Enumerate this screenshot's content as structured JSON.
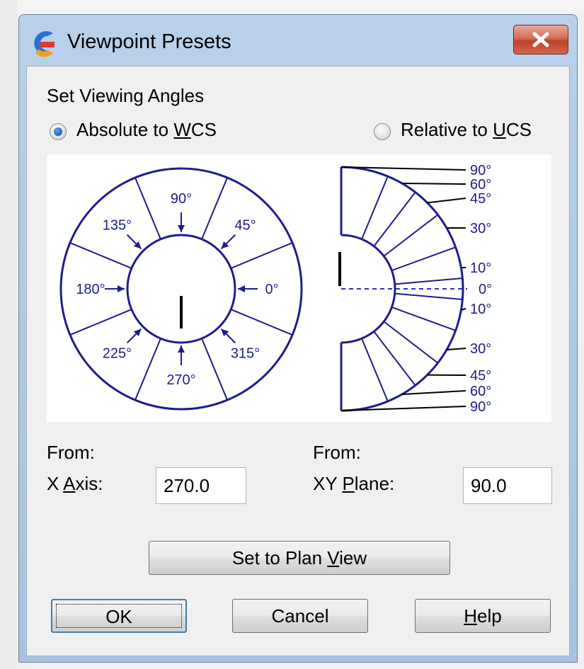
{
  "window": {
    "title": "Viewpoint Presets",
    "close_icon": "close-icon"
  },
  "section": {
    "label": "Set Viewing Angles"
  },
  "radios": {
    "absolute": {
      "pre": "Absolute to ",
      "key": "W",
      "post": "CS",
      "checked": true
    },
    "relative": {
      "pre": "Relative to ",
      "key": "U",
      "post": "CS",
      "checked": false
    }
  },
  "diagram": {
    "wcs_angles": [
      "90°",
      "45°",
      "0°",
      "315°",
      "270°",
      "225°",
      "180°",
      "135°"
    ],
    "xy_angles_top": [
      "90°",
      "60°",
      "45°",
      "30°",
      "10°"
    ],
    "xy_center": "0°",
    "xy_angles_bottom": [
      "10°",
      "30°",
      "45°",
      "60°",
      "90°"
    ]
  },
  "x_axis": {
    "from_label": "From:",
    "label_pre": "X ",
    "label_key": "A",
    "label_post": "xis:",
    "value": "270.0"
  },
  "xy_plane": {
    "from_label": "From:",
    "label_pre": "XY ",
    "label_key": "P",
    "label_post": "lane:",
    "value": "90.0"
  },
  "buttons": {
    "plan_pre": "Set to Plan ",
    "plan_key": "V",
    "plan_post": "iew",
    "ok": "OK",
    "cancel": "Cancel",
    "help_key": "H",
    "help_post": "elp"
  },
  "colors": {
    "diagram_ink": "#1d1d8c",
    "titlebar": "#b9d1ea",
    "close_button": "#c0432b"
  }
}
